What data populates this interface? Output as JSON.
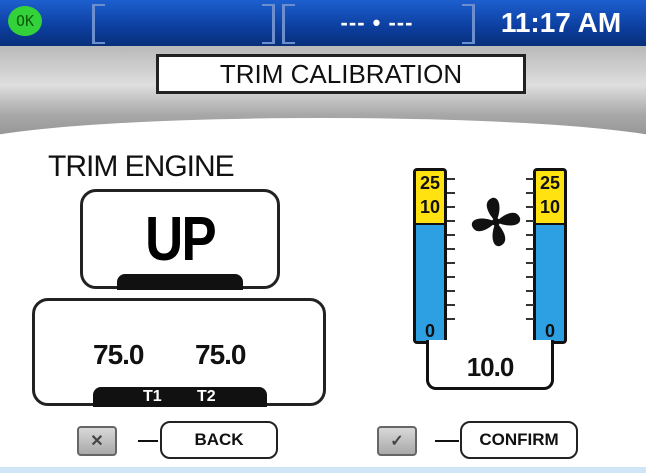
{
  "status_bar": {
    "ok_badge": "OK",
    "center_text": "--- • ---",
    "time": "11:17 AM"
  },
  "header": {
    "title": "TRIM CALIBRATION"
  },
  "trim_engine": {
    "label": "TRIM ENGINE",
    "direction": "UP",
    "temps": {
      "t1_value": "75.0",
      "t2_value": "75.0",
      "t1_label": "T1",
      "t2_label": "T2"
    }
  },
  "gauges": {
    "left": {
      "top_label": "25",
      "mid_label": "10",
      "bottom_label": "0"
    },
    "right": {
      "top_label": "25",
      "mid_label": "10",
      "bottom_label": "0"
    },
    "reading": "10.0",
    "icon": "propeller-icon",
    "colors": {
      "warning_zone": "#ffe20f",
      "normal_zone": "#2d9fe3"
    }
  },
  "buttons": {
    "back_icon": "✕",
    "back_label": "BACK",
    "confirm_icon": "✓",
    "confirm_label": "CONFIRM"
  }
}
